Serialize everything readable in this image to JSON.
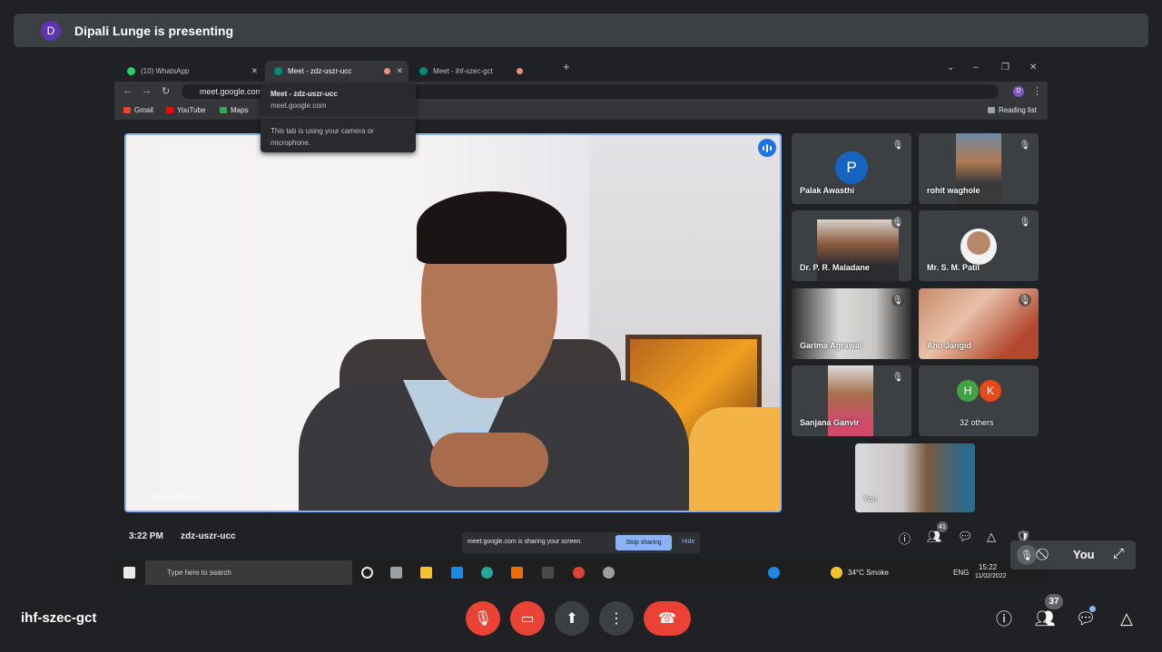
{
  "banner": {
    "avatar": "D",
    "text": "Dipali Lunge is presenting"
  },
  "shared": {
    "tabs": [
      {
        "label": "(10) WhatsApp",
        "icon": "whatsapp-icon",
        "color": "#25d366"
      },
      {
        "label": "Meet - zdz-uszr-ucc",
        "icon": "meet-icon",
        "color": "#00897b"
      },
      {
        "label": "Meet - ihf-szec-gct",
        "icon": "meet-icon",
        "color": "#00897b"
      }
    ],
    "url": "meet.google.com",
    "bookmarks": [
      "Gmail",
      "YouTube",
      "Maps"
    ],
    "reading_list": "Reading list",
    "tooltip": {
      "title": "Meet - zdz-uszr-ucc",
      "url": "meet.google.com",
      "note": "This tab is using your camera or microphone."
    },
    "main_name": "Amit Madhukar",
    "tiles": [
      {
        "name": "Palak Awasthi",
        "initial": "P",
        "color": "#1565c0"
      },
      {
        "name": "rohit waghole"
      },
      {
        "name": "Dr. P. R. Maladane"
      },
      {
        "name": "Mr. S. M. Patil"
      },
      {
        "name": "Garima Agrawal"
      },
      {
        "name": "Anu Jangid"
      },
      {
        "name": "Sanjana Ganvir"
      },
      {
        "name": "32 others",
        "avatars": [
          "H",
          "K"
        ]
      },
      {
        "name": "You"
      }
    ],
    "bar": {
      "time": "3:22 PM",
      "code": "zdz-uszr-ucc",
      "people_count": "41"
    },
    "share_note": {
      "text": "meet.google.com is sharing your screen.",
      "stop": "Stop sharing",
      "hide": "Hide"
    },
    "taskbar": {
      "search": "Type here to search",
      "weather": "34°C  Smoke",
      "lang": "ENG",
      "time": "15:22",
      "date": "11/02/2022"
    }
  },
  "self_view": {
    "label": "You"
  },
  "bottom": {
    "meeting_code": "ihf-szec-gct",
    "people_count": "37"
  }
}
